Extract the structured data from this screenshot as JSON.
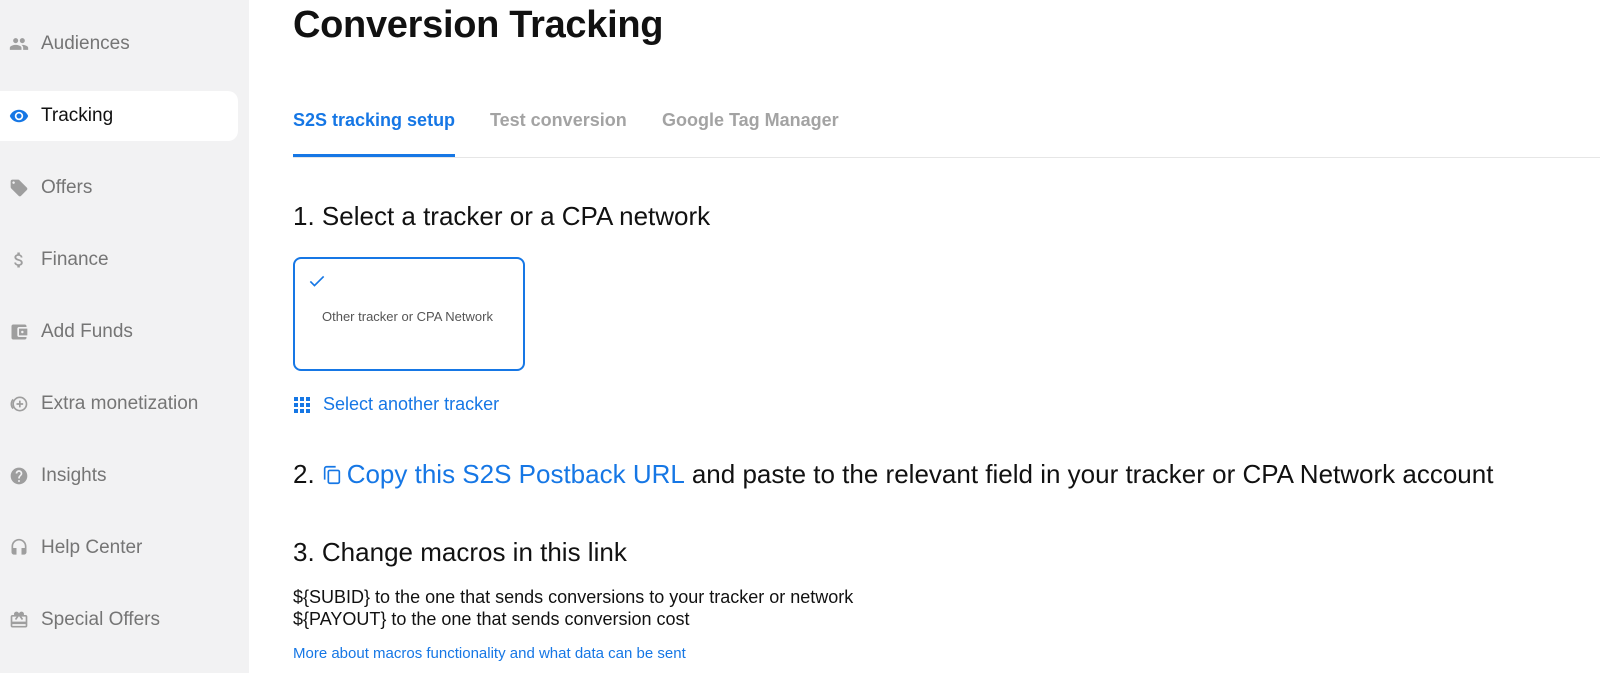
{
  "sidebar": {
    "items": [
      {
        "label": "Audiences",
        "icon": "people-icon",
        "active": false
      },
      {
        "label": "Tracking",
        "icon": "eye-icon",
        "active": true
      },
      {
        "label": "Offers",
        "icon": "tag-icon",
        "active": false
      },
      {
        "label": "Finance",
        "icon": "dollar-icon",
        "active": false
      },
      {
        "label": "Add Funds",
        "icon": "wallet-icon",
        "active": false
      },
      {
        "label": "Extra monetization",
        "icon": "add-circle-icon",
        "active": false
      },
      {
        "label": "Insights",
        "icon": "help-circle-icon",
        "active": false
      },
      {
        "label": "Help Center",
        "icon": "headset-icon",
        "active": false
      },
      {
        "label": "Special Offers",
        "icon": "gift-icon",
        "active": false
      }
    ]
  },
  "page": {
    "title": "Conversion Tracking"
  },
  "tabs": [
    {
      "label": "S2S tracking setup",
      "active": true
    },
    {
      "label": "Test conversion",
      "active": false
    },
    {
      "label": "Google Tag Manager",
      "active": false
    }
  ],
  "step1": {
    "heading": "1. Select a tracker or a CPA network",
    "selected_tracker": "Other tracker or CPA Network",
    "select_another": "Select another tracker"
  },
  "step2": {
    "number": "2.",
    "copy_link": "Copy this S2S Postback URL",
    "rest": "and paste to the relevant field in your tracker or CPA Network account"
  },
  "step3": {
    "heading": "3. Change macros in this link",
    "lines": [
      "${SUBID} to the one that sends conversions to your tracker or network",
      "${PAYOUT} to the one that sends conversion cost"
    ],
    "more_link": "More about macros functionality and what data can be sent"
  },
  "colors": {
    "accent": "#1677e5",
    "sidebar_bg": "#f2f2f3",
    "muted": "#a3a3a3"
  }
}
